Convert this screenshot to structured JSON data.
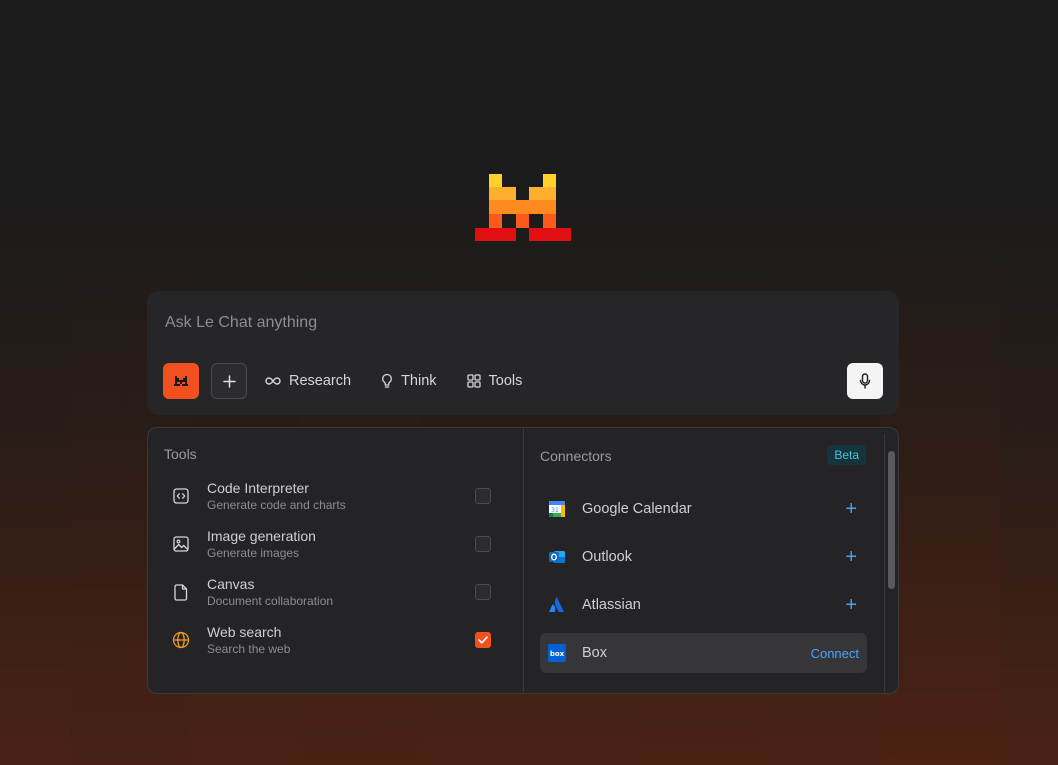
{
  "composer": {
    "placeholder": "Ask Le Chat anything",
    "research_label": "Research",
    "think_label": "Think",
    "tools_label": "Tools"
  },
  "tools_panel": {
    "title": "Tools",
    "items": [
      {
        "name": "Code Interpreter",
        "desc": "Generate code and charts",
        "checked": false,
        "icon": "code-icon"
      },
      {
        "name": "Image generation",
        "desc": "Generate images",
        "checked": false,
        "icon": "image-icon"
      },
      {
        "name": "Canvas",
        "desc": "Document collaboration",
        "checked": false,
        "icon": "document-icon"
      },
      {
        "name": "Web search",
        "desc": "Search the web",
        "checked": true,
        "icon": "globe-icon"
      }
    ]
  },
  "connectors_panel": {
    "title": "Connectors",
    "badge": "Beta",
    "items": [
      {
        "name": "Google Calendar",
        "action": "+",
        "icon": "google-calendar-icon"
      },
      {
        "name": "Outlook",
        "action": "+",
        "icon": "outlook-icon"
      },
      {
        "name": "Atlassian",
        "action": "+",
        "icon": "atlassian-icon"
      },
      {
        "name": "Box",
        "action": "Connect",
        "icon": "box-icon"
      }
    ]
  },
  "colors": {
    "accent": "#f2501e",
    "link": "#4aa3ff",
    "beta_text": "#3fc7e0"
  }
}
